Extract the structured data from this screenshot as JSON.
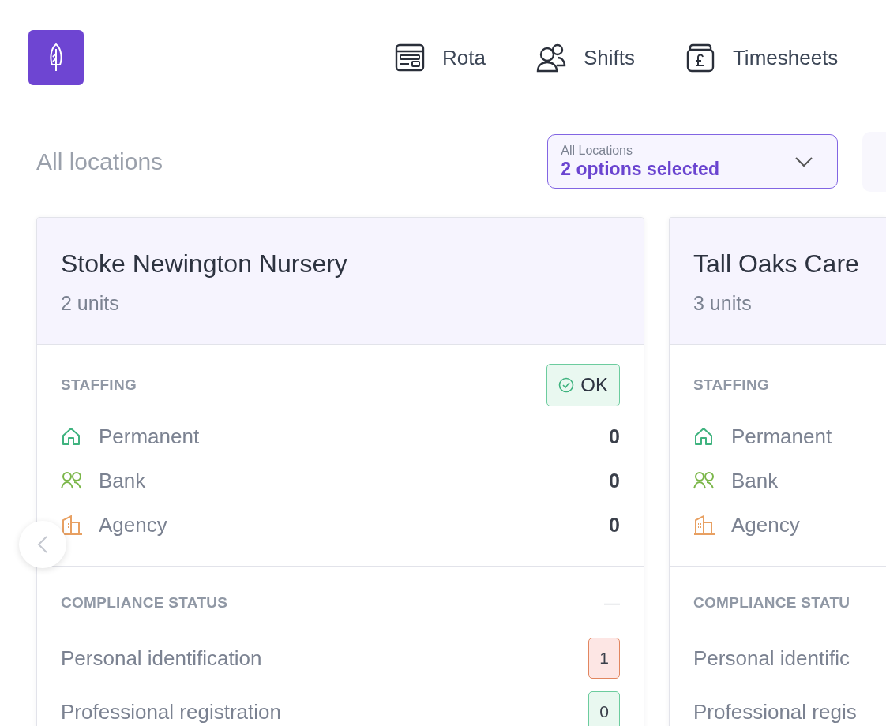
{
  "nav": [
    {
      "kind": "rota",
      "label": "Rota"
    },
    {
      "kind": "shifts",
      "label": "Shifts"
    },
    {
      "kind": "timesheets",
      "label": "Timesheets"
    }
  ],
  "page_title": "All locations",
  "location_filter": {
    "label": "All Locations",
    "value": "2 options selected"
  },
  "cards": [
    {
      "title": "Stoke Newington Nursery",
      "subtitle": "2 units",
      "staffing": {
        "label": "STAFFING",
        "status": {
          "kind": "ok",
          "label": "OK"
        },
        "rows": [
          {
            "kind": "permanent",
            "label": "Permanent",
            "value": "0"
          },
          {
            "kind": "bank",
            "label": "Bank",
            "value": "0"
          },
          {
            "kind": "agency",
            "label": "Agency",
            "value": "0"
          }
        ]
      },
      "compliance": {
        "label": "COMPLIANCE STATUS",
        "toggle": "—",
        "rows": [
          {
            "label": "Personal identification",
            "value": "1",
            "kind": "alert"
          },
          {
            "label": "Professional registration",
            "value": "0",
            "kind": "ok"
          }
        ]
      }
    },
    {
      "title": "Tall Oaks Care",
      "subtitle": "3 units",
      "staffing": {
        "label": "STAFFING",
        "rows": [
          {
            "kind": "permanent",
            "label": "Permanent"
          },
          {
            "kind": "bank",
            "label": "Bank"
          },
          {
            "kind": "agency",
            "label": "Agency"
          }
        ]
      },
      "compliance": {
        "label": "COMPLIANCE STATU",
        "rows": [
          {
            "label": "Personal identific"
          },
          {
            "label": "Professional regis"
          }
        ]
      }
    }
  ]
}
